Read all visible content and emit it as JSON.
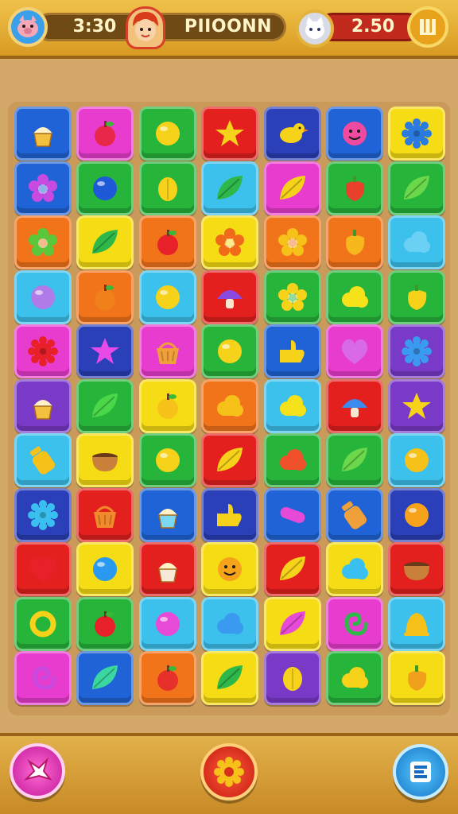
{
  "hud": {
    "timer": "3:30",
    "player_name": "PIIOONN",
    "score": "2.50"
  },
  "colors": {
    "blue": "#1f63d6",
    "pink": "#e83ccf",
    "green": "#27b43a",
    "red": "#e3201e",
    "navy": "#2a3fb8",
    "yellow": "#f6dc14",
    "orange": "#f2741a",
    "cyan": "#3cc0ec",
    "purple": "#7a3ac8"
  },
  "board": {
    "rows": [
      [
        {
          "c": "blue",
          "i": "cupcake-icon",
          "ic": "#f4c040"
        },
        {
          "c": "pink",
          "i": "apple-icon",
          "ic": "#e8284a"
        },
        {
          "c": "green",
          "i": "ball-icon",
          "ic": "#f6d21a"
        },
        {
          "c": "red",
          "i": "star-icon",
          "ic": "#f6d21a"
        },
        {
          "c": "navy",
          "i": "bird-icon",
          "ic": "#f6d21a"
        },
        {
          "c": "blue",
          "i": "face-icon",
          "ic": "#f04aa0"
        },
        {
          "c": "yellow",
          "i": "gear-icon",
          "ic": "#2a7ae0"
        }
      ],
      [
        {
          "c": "blue",
          "i": "flower-icon",
          "ic": "#c84ae0"
        },
        {
          "c": "green",
          "i": "ball-icon",
          "ic": "#1e5ad8"
        },
        {
          "c": "green",
          "i": "lemon-icon",
          "ic": "#f6d21a"
        },
        {
          "c": "cyan",
          "i": "leaf-icon",
          "ic": "#2eb84a"
        },
        {
          "c": "pink",
          "i": "leaf-icon",
          "ic": "#f6d21a"
        },
        {
          "c": "green",
          "i": "pepper-icon",
          "ic": "#e8402a"
        },
        {
          "c": "green",
          "i": "leaf-icon",
          "ic": "#6ad84a"
        }
      ],
      [
        {
          "c": "orange",
          "i": "flower-icon",
          "ic": "#5ac83a"
        },
        {
          "c": "yellow",
          "i": "leaf-icon",
          "ic": "#2eb84a"
        },
        {
          "c": "orange",
          "i": "apple-icon",
          "ic": "#e8202a"
        },
        {
          "c": "yellow",
          "i": "flower-icon",
          "ic": "#f06a1a"
        },
        {
          "c": "orange",
          "i": "flower-icon",
          "ic": "#f6c21a"
        },
        {
          "c": "orange",
          "i": "pepper-icon",
          "ic": "#f6b81a"
        },
        {
          "c": "cyan",
          "i": "cloud-icon",
          "ic": "#6ad0f4"
        }
      ],
      [
        {
          "c": "cyan",
          "i": "ball-icon",
          "ic": "#b07ae8"
        },
        {
          "c": "orange",
          "i": "apple-icon",
          "ic": "#f0801a"
        },
        {
          "c": "cyan",
          "i": "ball-icon",
          "ic": "#f6d21a"
        },
        {
          "c": "red",
          "i": "mushroom-icon",
          "ic": "#8a4ae0"
        },
        {
          "c": "green",
          "i": "flower-icon",
          "ic": "#f6d21a"
        },
        {
          "c": "green",
          "i": "cloud-icon",
          "ic": "#f6e21a"
        },
        {
          "c": "green",
          "i": "pepper-icon",
          "ic": "#f6d21a"
        }
      ],
      [
        {
          "c": "pink",
          "i": "gear-icon",
          "ic": "#e8202a"
        },
        {
          "c": "navy",
          "i": "star-icon",
          "ic": "#e84ae8"
        },
        {
          "c": "pink",
          "i": "basket-icon",
          "ic": "#f0a03a"
        },
        {
          "c": "green",
          "i": "ball-icon",
          "ic": "#f6d21a"
        },
        {
          "c": "blue",
          "i": "thumb-icon",
          "ic": "#f6d21a"
        },
        {
          "c": "pink",
          "i": "heart-icon",
          "ic": "#d86ae8"
        },
        {
          "c": "purple",
          "i": "gear-icon",
          "ic": "#3a9af0"
        }
      ],
      [
        {
          "c": "purple",
          "i": "cupcake-icon",
          "ic": "#f4c040"
        },
        {
          "c": "green",
          "i": "leaf-icon",
          "ic": "#4ad84a"
        },
        {
          "c": "yellow",
          "i": "apple-icon",
          "ic": "#f6c21a"
        },
        {
          "c": "orange",
          "i": "cloud-icon",
          "ic": "#f6c21a"
        },
        {
          "c": "cyan",
          "i": "cloud-icon",
          "ic": "#f6e21a"
        },
        {
          "c": "red",
          "i": "mushroom-icon",
          "ic": "#3a8af0"
        },
        {
          "c": "purple",
          "i": "star-icon",
          "ic": "#f6d21a"
        }
      ],
      [
        {
          "c": "cyan",
          "i": "bottle-icon",
          "ic": "#f6c21a"
        },
        {
          "c": "yellow",
          "i": "bowl-icon",
          "ic": "#c8803a"
        },
        {
          "c": "green",
          "i": "ball-icon",
          "ic": "#f6d21a"
        },
        {
          "c": "red",
          "i": "leaf-icon",
          "ic": "#f6d21a"
        },
        {
          "c": "green",
          "i": "cloud-icon",
          "ic": "#f0502a"
        },
        {
          "c": "green",
          "i": "leaf-icon",
          "ic": "#6ad84a"
        },
        {
          "c": "cyan",
          "i": "ball-icon",
          "ic": "#f6c21a"
        }
      ],
      [
        {
          "c": "navy",
          "i": "gear-icon",
          "ic": "#3ac0f0"
        },
        {
          "c": "red",
          "i": "basket-icon",
          "ic": "#f08a2a"
        },
        {
          "c": "blue",
          "i": "cupcake-icon",
          "ic": "#7ad8f4"
        },
        {
          "c": "navy",
          "i": "thumb-icon",
          "ic": "#f6d21a"
        },
        {
          "c": "blue",
          "i": "pill-icon",
          "ic": "#e84ad8"
        },
        {
          "c": "blue",
          "i": "bottle-icon",
          "ic": "#f0a03a"
        },
        {
          "c": "navy",
          "i": "ball-icon",
          "ic": "#f6a21a"
        }
      ],
      [
        {
          "c": "red",
          "i": "heart-icon",
          "ic": "#e8202a"
        },
        {
          "c": "yellow",
          "i": "ball-icon",
          "ic": "#2a9af0"
        },
        {
          "c": "red",
          "i": "cupcake-icon",
          "ic": "#f8e8d8"
        },
        {
          "c": "yellow",
          "i": "face-icon",
          "ic": "#f6a21a"
        },
        {
          "c": "red",
          "i": "leaf-icon",
          "ic": "#f6d21a"
        },
        {
          "c": "yellow",
          "i": "cloud-icon",
          "ic": "#3ac0f0"
        },
        {
          "c": "red",
          "i": "bowl-icon",
          "ic": "#c8803a"
        }
      ],
      [
        {
          "c": "green",
          "i": "ring-icon",
          "ic": "#f6d21a"
        },
        {
          "c": "green",
          "i": "apple-icon",
          "ic": "#e8202a"
        },
        {
          "c": "cyan",
          "i": "ball-icon",
          "ic": "#e84ad8"
        },
        {
          "c": "cyan",
          "i": "cloud-icon",
          "ic": "#3a9af0"
        },
        {
          "c": "yellow",
          "i": "leaf-icon",
          "ic": "#e84ad8"
        },
        {
          "c": "pink",
          "i": "swirl-icon",
          "ic": "#2eb84a"
        },
        {
          "c": "cyan",
          "i": "bell-icon",
          "ic": "#f6c21a"
        }
      ],
      [
        {
          "c": "pink",
          "i": "swirl-icon",
          "ic": "#c84ae0"
        },
        {
          "c": "blue",
          "i": "leaf-icon",
          "ic": "#3ad8a0"
        },
        {
          "c": "orange",
          "i": "apple-icon",
          "ic": "#e8302a"
        },
        {
          "c": "yellow",
          "i": "leaf-icon",
          "ic": "#2eb84a"
        },
        {
          "c": "purple",
          "i": "lemon-icon",
          "ic": "#f6d21a"
        },
        {
          "c": "green",
          "i": "cloud-icon",
          "ic": "#f6d21a"
        },
        {
          "c": "yellow",
          "i": "pepper-icon",
          "ic": "#f0a01a"
        }
      ]
    ]
  }
}
